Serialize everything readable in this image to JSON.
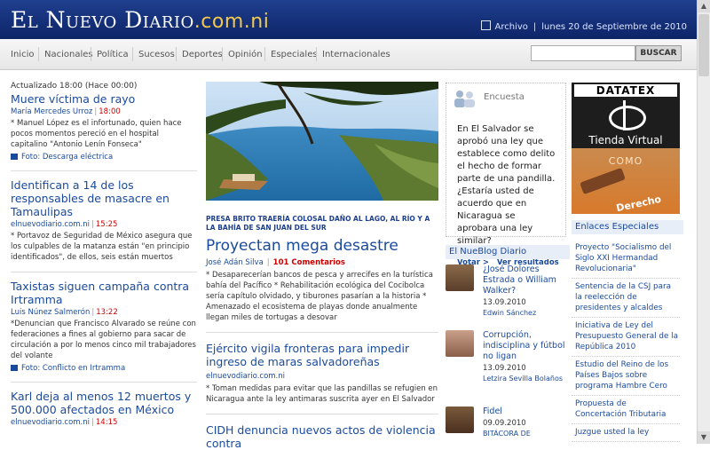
{
  "header": {
    "logo_main": "El Nuevo Diario",
    "logo_domain": ".com.ni",
    "archive_label": "Archivo",
    "date": "lunes 20 de Septiembre de 2010"
  },
  "nav": {
    "items": [
      "Inicio",
      "Nacionales",
      "Política",
      "Sucesos",
      "Deportes",
      "Opinión",
      "Especiales",
      "Internacionales"
    ],
    "search_button": "BUSCAR"
  },
  "left": {
    "updated": "Actualizado 18:00 (Hace 00:00)",
    "stories": [
      {
        "title": "Muere víctima de rayo",
        "author": "María Mercedes Urroz",
        "time": "18:00",
        "summary": "* Manuel López es el infortunado, quien hace pocos momentos pereció en el hospital capitalino \"Antonio Lenín Fonseca\"",
        "media": "Foto: Descarga eléctrica"
      },
      {
        "title": "Identifican a 14 de los responsables de masacre en Tamaulipas",
        "author": "elnuevodiario.com.ni",
        "time": "15:25",
        "summary": "* Portavoz de Seguridad de México asegura que los culpables de la matanza están \"en principio identificados\", de ellos, seis están muertos",
        "media": ""
      },
      {
        "title": "Taxistas siguen campaña contra Irtramma",
        "author": "Luis Núnez Salmerón",
        "time": "13:22",
        "summary": "*Denuncian que Francisco Alvarado se reúne con federaciones a fines al gobierno para sacar de circulación a por lo menos cinco mil trabajadores del volante",
        "media": "Foto: Conflicto en Irtramma"
      },
      {
        "title": "Karl deja al menos 12 muertos y 500.000 afectados en México",
        "author": "elnuevodiario.com.ni",
        "time": "14:15",
        "summary": "",
        "media": ""
      }
    ]
  },
  "center": {
    "kicker": "PRESA BRITO TRAERÍA COLOSAL DAÑO AL LAGO, AL RÍO Y A LA BAHÍA DE SAN JUAN DEL SUR",
    "headline": "Proyectan mega desastre",
    "author": "José Adán Silva",
    "comments": "101 Comentarios",
    "summary": "* Desaparecerían bancos de pesca y arrecifes en la turística bahía del Pacífico * Rehabilitación ecológica del Cocibolca sería capítulo olvidado, y tiburones pasarían a la historia * Amenazado el ecosistema de playas donde anualmente llegan miles de tortugas a desovar",
    "story2_title": "Ejército vigila fronteras para impedir ingreso de maras salvadoreñas",
    "story2_author": "elnuevodiario.com.ni",
    "story2_summary": "* Toman medidas para evitar que las pandillas se refugien en Nicaragua ante la ley antimaras suscrita ayer en El Salvador",
    "story3_title": "CIDH denuncia nuevos actos de violencia contra"
  },
  "poll": {
    "heading": "Encuesta",
    "question": "En El Salvador se aprobó una ley que establece como delito el hecho de formar parte de una pandilla. ¿Estaría usted de acuerdo que en Nicaragua se aprobara una ley similar?",
    "vote": "Votar >",
    "results": "Ver resultados >"
  },
  "blog": {
    "heading": "El NueBlog Diario",
    "items": [
      {
        "title": "¿José Dolores Estrada o William Walker?",
        "date": "13.09.2010",
        "author": "Edwin Sánchez"
      },
      {
        "title": "Corrupción, indisciplina y fútbol no ligan",
        "date": "13.09.2010",
        "author": "Letzira Sevilla Bolaños"
      },
      {
        "title": "Fidel",
        "date": "09.09.2010",
        "author": "BITÁCORA DE"
      }
    ]
  },
  "ad": {
    "brand": "DATATEX",
    "store": "Tienda Virtual",
    "como": "COMO",
    "derecho": "Derecho"
  },
  "enlaces": {
    "heading": "Enlaces Especiales",
    "items": [
      "Proyecto \"Socialismo del Siglo XXI Hermandad Revolucionaria\"",
      "Sentencia de la CSJ para la reelección de presidentes y alcaldes",
      "Iniciativa de Ley del Presupuesto General de la República 2010",
      "Estudio del Reino de los Países Bajos sobre programa Hambre Cero",
      "Propuesta de Concertación Tributaria",
      "Juzgue usted la ley"
    ]
  }
}
